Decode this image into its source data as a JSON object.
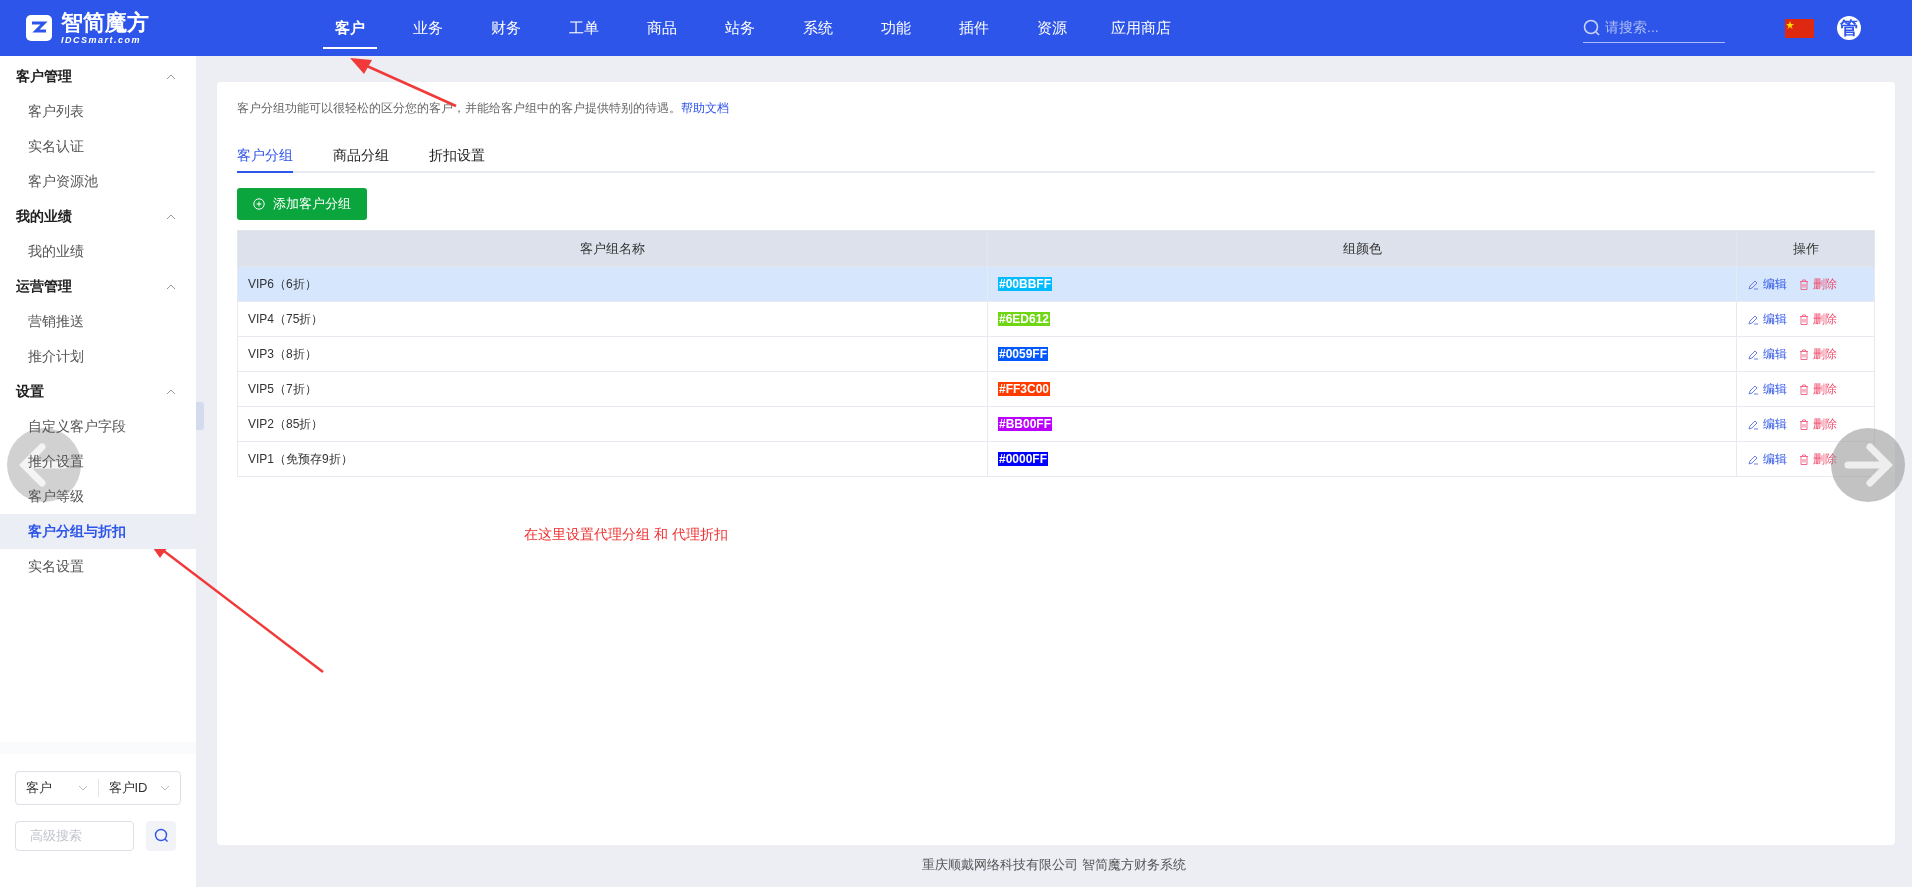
{
  "header": {
    "logo_title": "智简魔方",
    "logo_subtitle": "IDCSmart.com",
    "nav": [
      {
        "label": "客户",
        "selected": true
      },
      {
        "label": "业务",
        "selected": false
      },
      {
        "label": "财务",
        "selected": false
      },
      {
        "label": "工单",
        "selected": false
      },
      {
        "label": "商品",
        "selected": false
      },
      {
        "label": "站务",
        "selected": false
      },
      {
        "label": "系统",
        "selected": false
      },
      {
        "label": "功能",
        "selected": false
      },
      {
        "label": "插件",
        "selected": false
      },
      {
        "label": "资源",
        "selected": false
      },
      {
        "label": "应用商店",
        "selected": false
      }
    ],
    "search": {
      "placeholder": "请搜索..."
    },
    "avatar": "管"
  },
  "sidebar": {
    "groups": [
      {
        "title": "客户管理",
        "expanded": true,
        "items": [
          {
            "label": "客户列表",
            "selected": false
          },
          {
            "label": "实名认证",
            "selected": false
          },
          {
            "label": "客户资源池",
            "selected": false
          }
        ]
      },
      {
        "title": "我的业绩",
        "expanded": true,
        "items": [
          {
            "label": "我的业绩",
            "selected": false
          }
        ]
      },
      {
        "title": "运营管理",
        "expanded": true,
        "items": [
          {
            "label": "营销推送",
            "selected": false
          },
          {
            "label": "推介计划",
            "selected": false
          }
        ]
      },
      {
        "title": "设置",
        "expanded": true,
        "items": [
          {
            "label": "自定义客户字段",
            "selected": false
          },
          {
            "label": "推介设置",
            "selected": false
          },
          {
            "label": "客户等级",
            "selected": false
          },
          {
            "label": "客户分组与折扣",
            "selected": true
          },
          {
            "label": "实名设置",
            "selected": false
          }
        ]
      }
    ],
    "filter": {
      "type": "客户",
      "field": "客户ID",
      "search_placeholder": "高级搜索"
    }
  },
  "content": {
    "description": "客户分组功能可以很轻松的区分您的客户，并能给客户组中的客户提供特别的待遇。",
    "help_link": "帮助文档",
    "tabs": [
      {
        "label": "客户分组",
        "selected": true
      },
      {
        "label": "商品分组",
        "selected": false
      },
      {
        "label": "折扣设置",
        "selected": false
      }
    ],
    "add_button": "添加客户分组",
    "table": {
      "columns": [
        "客户组名称",
        "组颜色",
        "操作"
      ],
      "rows": [
        {
          "name": "VIP6（6折）",
          "color": "#00bbff",
          "color_label": "#00BBFF",
          "selected": true,
          "edit": "编辑",
          "delete": "删除"
        },
        {
          "name": "VIP4（75折）",
          "color": "#6ed612",
          "color_label": "#6ED612",
          "selected": false,
          "edit": "编辑",
          "delete": "删除"
        },
        {
          "name": "VIP3（8折）",
          "color": "#0059ff",
          "color_label": "#0059FF",
          "selected": false,
          "edit": "编辑",
          "delete": "删除"
        },
        {
          "name": "VIP5（7折）",
          "color": "#ff3c00",
          "color_label": "#FF3C00",
          "selected": false,
          "edit": "编辑",
          "delete": "删除"
        },
        {
          "name": "VIP2（85折）",
          "color": "#bb00ff",
          "color_label": "#BB00FF",
          "selected": false,
          "edit": "编辑",
          "delete": "删除"
        },
        {
          "name": "VIP1（免预存9折）",
          "color": "#0000ff",
          "color_label": "#0000FF",
          "selected": false,
          "edit": "编辑",
          "delete": "删除"
        }
      ]
    },
    "annotation": "在这里设置代理分组 和 代理折扣"
  },
  "footer": "重庆顺戴网络科技有限公司 智简魔方财务系统"
}
